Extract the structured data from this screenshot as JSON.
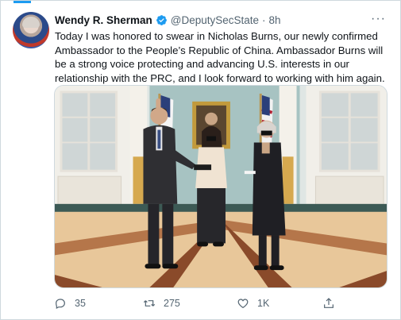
{
  "author": {
    "name": "Wendy R. Sherman",
    "handle": "@DeputySecState",
    "separator": "·",
    "time": "8h"
  },
  "tweet": {
    "text": "Today I was honored to swear in Nicholas Burns, our newly confirmed Ambassador to the People’s Republic of China. Ambassador Burns will be a strong voice protecting and advancing U.S. interests in our relationship with the PRC, and I look forward to working with him again."
  },
  "actions": {
    "replies": "35",
    "retweets": "275",
    "likes": "1K"
  },
  "icons": {
    "verified": "verified-badge-icon",
    "more": "more-horizontal-icon",
    "reply": "reply-icon",
    "retweet": "retweet-icon",
    "like": "heart-icon",
    "share": "share-icon"
  },
  "colors": {
    "accent": "#1d9bf0",
    "muted_text": "#536471",
    "border": "#cfd9de"
  }
}
